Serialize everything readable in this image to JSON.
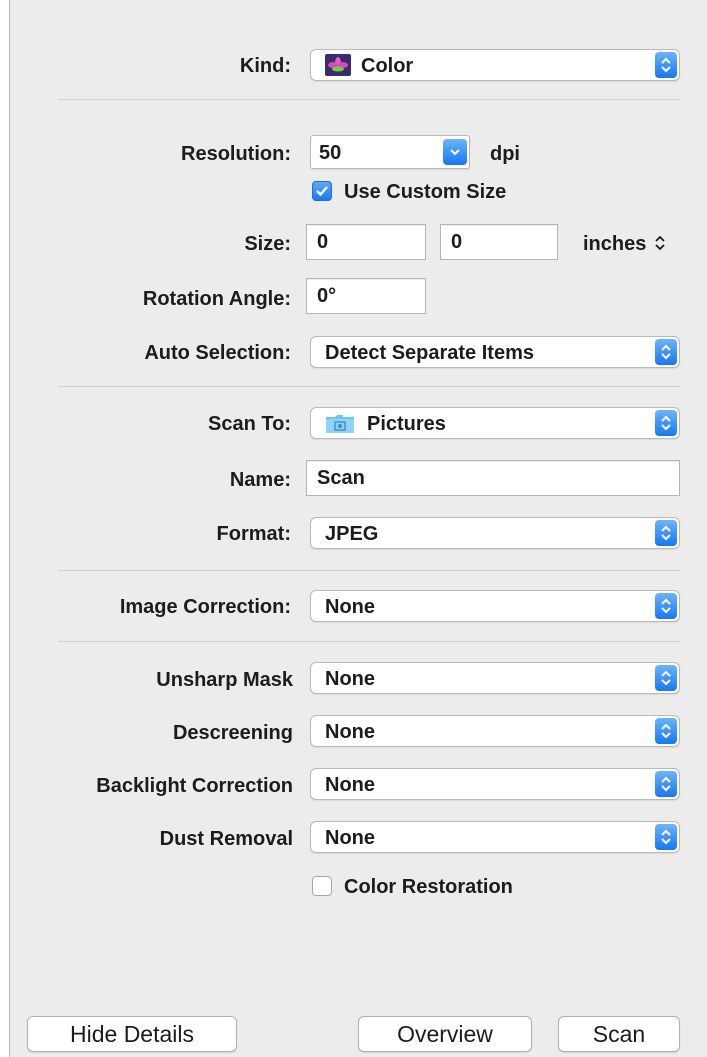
{
  "kind": {
    "label": "Kind:",
    "value": "Color",
    "icon": "color-flower-icon"
  },
  "resolution": {
    "label": "Resolution:",
    "value": "50",
    "unit": "dpi"
  },
  "custom_size": {
    "label": "Use Custom Size",
    "checked": true
  },
  "size": {
    "label": "Size:",
    "width": "0",
    "height": "0",
    "unit": "inches"
  },
  "rotation": {
    "label": "Rotation Angle:",
    "value": "0°"
  },
  "auto_selection": {
    "label": "Auto Selection:",
    "value": "Detect Separate Items"
  },
  "scan_to": {
    "label": "Scan To:",
    "value": "Pictures",
    "icon": "pictures-folder-icon"
  },
  "name": {
    "label": "Name:",
    "value": "Scan"
  },
  "format": {
    "label": "Format:",
    "value": "JPEG"
  },
  "image_correction": {
    "label": "Image Correction:",
    "value": "None"
  },
  "unsharp_mask": {
    "label": "Unsharp Mask",
    "value": "None"
  },
  "descreening": {
    "label": "Descreening",
    "value": "None"
  },
  "backlight": {
    "label": "Backlight Correction",
    "value": "None"
  },
  "dust_removal": {
    "label": "Dust Removal",
    "value": "None"
  },
  "color_restoration": {
    "label": "Color Restoration",
    "checked": false
  },
  "buttons": {
    "hide_details": "Hide Details",
    "overview": "Overview",
    "scan": "Scan"
  },
  "colors": {
    "accent": "#1877f2",
    "panel": "#ececec"
  }
}
